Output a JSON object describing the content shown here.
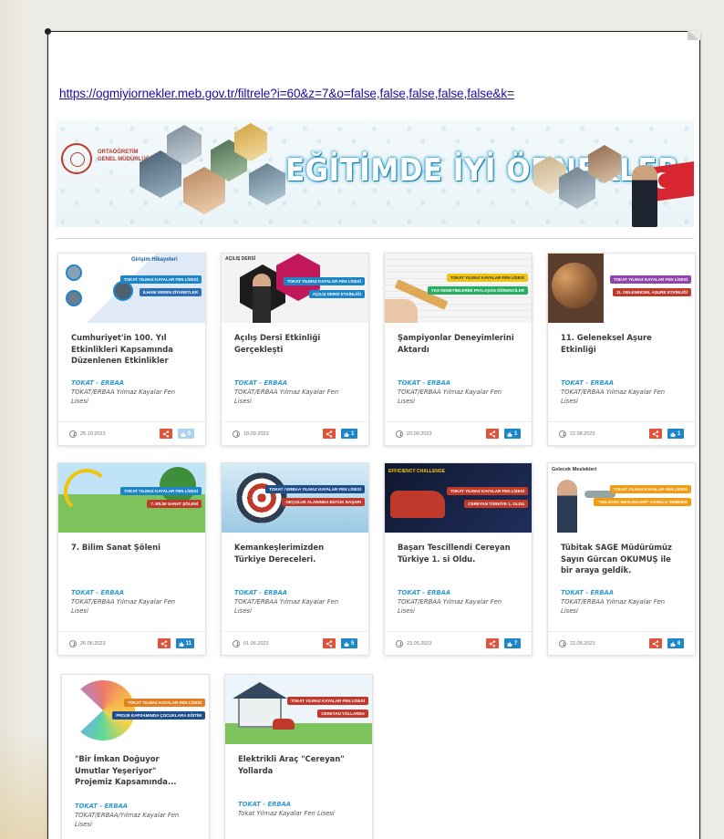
{
  "url": {
    "text": "https://ogmiyiornekler.meb.gov.tr/filtrele?i=60&z=7&o=false,false,false,false,false&k",
    "tail": "="
  },
  "banner": {
    "title": "EĞİTİMDE İYİ ÖRNEKLER",
    "org_line1": "ORTAÖĞRETİM",
    "org_line2": "GENEL MÜDÜRLÜĞÜ"
  },
  "cards": [
    {
      "title": "Cumhuriyet'in 100. Yıl Etkinlikleri Kapsamında Düzenlenen Etkinlikler",
      "location": "TOKAT - ERBAA",
      "school": "TOKAT/ERBAA Yılmaz Kayalar Fen Lisesi",
      "date": "25.10.2023",
      "likes": "0",
      "thumb_ribbons": [
        "TOKAT YILMAZ KAYALAR FEN LİSESİ",
        "İLHAM VEREN ZİYARETLER"
      ],
      "thumb_text": "Girişim Hikayeleri"
    },
    {
      "title": "Açılış Dersi Etkinliği Gerçekleşti",
      "location": "TOKAT - ERBAA",
      "school": "TOKAT/ERBAA Yılmaz Kayalar Fen Lisesi",
      "date": "18.09.2023",
      "likes": "1",
      "thumb_ribbons": [
        "TOKAT YILMAZ KAYALAR FEN LİSESİ",
        "AÇILIŞ DERSİ ETKİNLİĞİ"
      ],
      "thumb_text": "AÇILIŞ DERSİ"
    },
    {
      "title": "Şampiyonlar Deneyimlerini Aktardı",
      "location": "TOKAT - ERBAA",
      "school": "TOKAT/ERBAA Yılmaz Kayalar Fen Lisesi",
      "date": "20.09.2023",
      "likes": "1",
      "thumb_ribbons": [
        "TOKAT YILMAZ KAYALAR FEN LİSESİ",
        "YKS DENEYİMLERİNİ PAYLAŞAN ÖĞRENCİLER"
      ],
      "thumb_text": ""
    },
    {
      "title": "11. Geleneksel Aşure Etkinliği",
      "location": "TOKAT - ERBAA",
      "school": "TOKAT/ERBAA Yılmaz Kayalar Fen Lisesi",
      "date": "22.08.2023",
      "likes": "1",
      "thumb_ribbons": [
        "TOKAT YILMAZ KAYALAR FEN LİSESİ",
        "11. GELENEKSEL AŞURE ETKİNLİĞİ"
      ],
      "thumb_text": ""
    },
    {
      "title": "7. Bilim Sanat Şöleni",
      "location": "TOKAT - ERBAA",
      "school": "TOKAT/ERBAA Yılmaz Kayalar Fen Lisesi",
      "date": "26.06.2023",
      "likes": "11",
      "thumb_ribbons": [
        "TOKAT YILMAZ KAYALAR FEN LİSESİ",
        "7. BİLİM SANAT ŞÖLENİ"
      ],
      "thumb_text": ""
    },
    {
      "title": "Kemankeşlerimizden Türkiye Dereceleri.",
      "location": "TOKAT - ERBAA",
      "school": "TOKAT/ERBAA Yılmaz Kayalar Fen Lisesi",
      "date": "01.06.2023",
      "likes": "5",
      "thumb_ribbons": [
        "TOKAT / ERBAA YILMAZ KAYALAR FEN LİSESİ",
        "OKÇULUK ALANINDA BÜYÜK BAŞARI"
      ],
      "thumb_text": ""
    },
    {
      "title": "Başarı Tescillendi Cereyan Türkiye 1. si Oldu.",
      "location": "TOKAT - ERBAA",
      "school": "TOKAT/ERBAA Yılmaz Kayalar Fen Lisesi",
      "date": "23.05.2023",
      "likes": "7",
      "thumb_ribbons": [
        "TOKAT YILMAZ KAYALAR FEN LİSESİ",
        "CEREYAN TÜRKİYE 1. OLDU"
      ],
      "thumb_text": "EFFICIENCY CHALLENGE"
    },
    {
      "title": "Tübitak SAGE Müdürümüz Sayın Gürcan OKUMUŞ ile bir araya geldik.",
      "location": "TOKAT - ERBAA",
      "school": "TOKAT/ERBAA Yılmaz Kayalar Fen Lisesi",
      "date": "22.05.2023",
      "likes": "6",
      "thumb_ribbons": [
        "TOKAT YILMAZ KAYALAR FEN LİSESİ",
        "\"GELECEK MESLEKLERİ\" KONULU SEMİNER"
      ],
      "thumb_text": "Gelecek Meslekleri"
    },
    {
      "title": "\"Bir İmkan Doğuyor Umutlar Yeşeriyor\" Projemiz Kapsamında...",
      "location": "TOKAT - ERBAA",
      "school": "TOKAT/ERBAA/Yılmaz Kayalar Fen Lisesi",
      "thumb_ribbons": [
        "TOKAT YILMAZ KAYALAR FEN LİSESİ",
        "PROJE KAPSAMINDA ÇOCUKLARA EĞİTİM"
      ],
      "thumb_text": ""
    },
    {
      "title": "Elektrikli Araç \"Cereyan\" Yollarda",
      "location": "TOKAT - ERBAA",
      "school": "Tokat Yılmaz Kayalar Fen Lisesi",
      "thumb_ribbons": [
        "TOKAT YILMAZ KAYALAR FEN LİSESİ",
        "CEREYAN YOLLARDA"
      ],
      "thumb_text": ""
    }
  ],
  "colors": {
    "link": "#1a0dab",
    "location": "#2c9bd6",
    "share": "#e0523a",
    "like": "#1d86c8",
    "ribbon_primary": "#1d86c8",
    "ribbon_secondary": "#c0392b"
  },
  "icons": {
    "date": "clock-icon",
    "share": "share-icon",
    "like": "thumbs-up-icon"
  }
}
